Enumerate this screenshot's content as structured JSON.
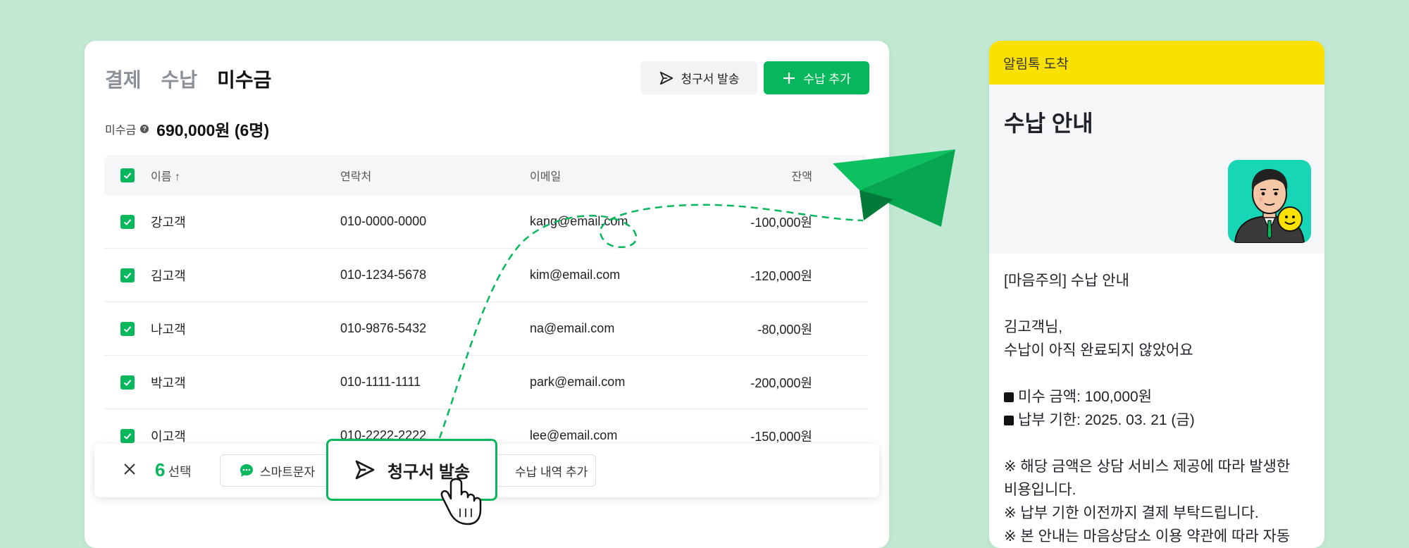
{
  "tabs": [
    {
      "label": "결제",
      "active": false
    },
    {
      "label": "수납",
      "active": false
    },
    {
      "label": "미수금",
      "active": true
    }
  ],
  "actions": {
    "send_invoice": "청구서 발송",
    "add_payment": "수납 추가"
  },
  "summary": {
    "label": "미수금",
    "amount": "690,000원 (6명)"
  },
  "table": {
    "headers": {
      "name": "이름 ↑",
      "phone": "연락처",
      "email": "이메일",
      "balance": "잔액"
    },
    "rows": [
      {
        "name": "강고객",
        "phone": "010-0000-0000",
        "email": "kang@email.com",
        "balance": "-100,000원"
      },
      {
        "name": "김고객",
        "phone": "010-1234-5678",
        "email": "kim@email.com",
        "balance": "-120,000원"
      },
      {
        "name": "나고객",
        "phone": "010-9876-5432",
        "email": "na@email.com",
        "balance": "-80,000원"
      },
      {
        "name": "박고객",
        "phone": "010-1111-1111",
        "email": "park@email.com",
        "balance": "-200,000원"
      },
      {
        "name": "이고객",
        "phone": "010-2222-2222",
        "email": "lee@email.com",
        "balance": "-150,000원"
      }
    ]
  },
  "action_bar": {
    "count": "6",
    "selected_label": "선택",
    "sms_label": "스마트문자",
    "send_label": "청구서 발송",
    "add_history_label": "수납 내역 추가"
  },
  "phone": {
    "header": "알림톡 도착",
    "title": "수납 안내",
    "message": {
      "line1": "[마음주의] 수납 안내",
      "line2": "김고객님,",
      "line3": "수납이 아직 완료되지 않았어요",
      "line4": "미수 금액: 100,000원",
      "line5": "납부 기한: 2025. 03. 21 (금)",
      "line6": "※ 해당 금액은 상담 서비스 제공에 따라 발생한",
      "line7": "비용입니다.",
      "line8": "※ 납부 기한 이전까지 결제 부탁드립니다.",
      "line9": "※ 본 안내는 마음상담소 이용 약관에 따라 자동"
    }
  },
  "colors": {
    "background": "#c1e8d2",
    "accent": "#06b85b",
    "kakao_yellow": "#fae100",
    "avatar_bg": "#17d6b5"
  }
}
